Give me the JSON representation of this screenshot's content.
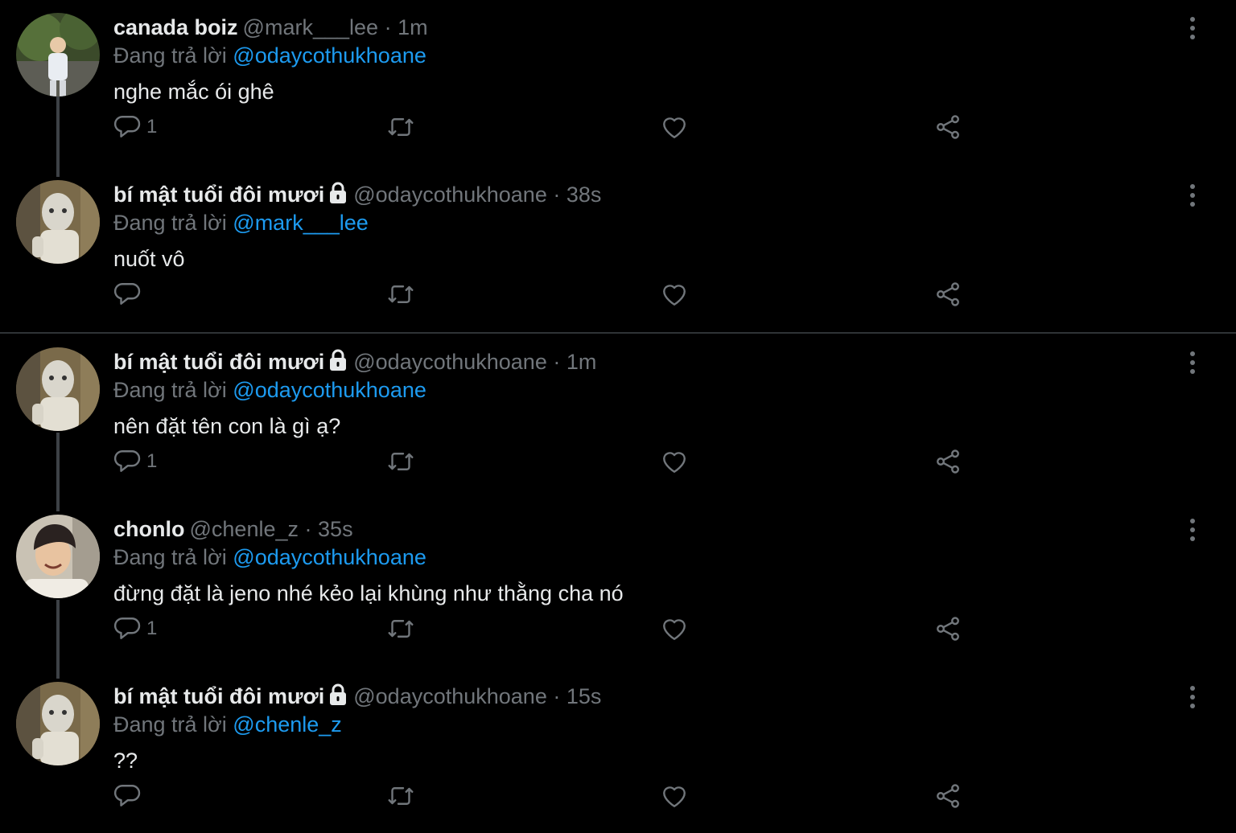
{
  "labels": {
    "replying_to": "Đang trả lời"
  },
  "colors": {
    "background": "#000000",
    "text": "#e7e9ea",
    "secondary": "#71767b",
    "link": "#1d9bf0",
    "divider": "#2f3336"
  },
  "icons": {
    "reply": "reply-icon",
    "retweet": "retweet-icon",
    "like": "heart-icon",
    "share": "share-icon",
    "more": "more-options-icon",
    "protected": "lock-icon"
  },
  "tweets": [
    {
      "name": "canada boiz",
      "handle": "@mark___lee",
      "dot": "·",
      "time": "1m",
      "replying_to_handle": "@odaycothukhoane",
      "text": "nghe mắc ói ghê",
      "reply_count": "1",
      "protected": false
    },
    {
      "name": "bí mật tuổi đôi mươi",
      "handle": "@odaycothukhoane",
      "dot": "·",
      "time": "38s",
      "replying_to_handle": "@mark___lee",
      "text": "nuốt vô",
      "reply_count": "",
      "protected": true
    },
    {
      "name": "bí mật tuổi đôi mươi",
      "handle": "@odaycothukhoane",
      "dot": "·",
      "time": "1m",
      "replying_to_handle": "@odaycothukhoane",
      "text": "nên đặt tên con là gì ạ?",
      "reply_count": "1",
      "protected": true
    },
    {
      "name": "chonlo",
      "handle": "@chenle_z",
      "dot": "·",
      "time": "35s",
      "replying_to_handle": "@odaycothukhoane",
      "text": "đừng đặt là jeno nhé kẻo lại khùng như thằng cha nó",
      "reply_count": "1",
      "protected": false
    },
    {
      "name": "bí mật tuổi đôi mươi",
      "handle": "@odaycothukhoane",
      "dot": "·",
      "time": "15s",
      "replying_to_handle": "@chenle_z",
      "text": "??",
      "reply_count": "",
      "protected": true
    }
  ]
}
